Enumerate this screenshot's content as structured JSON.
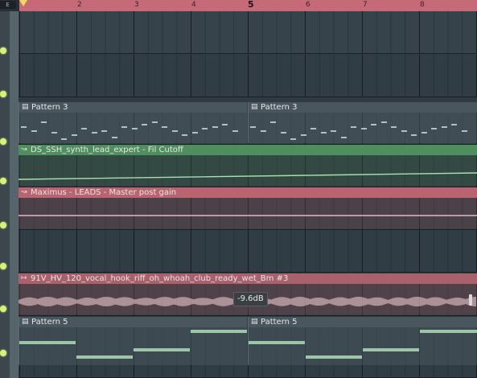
{
  "ruler": {
    "edit_label": "E",
    "bars": [
      "2",
      "3",
      "4",
      "5",
      "6",
      "7",
      "8"
    ]
  },
  "tracks": {
    "pattern3_label": "Pattern 3",
    "synth_auto_label": "DS_SSH_synth_lead_expert - Fil Cutoff",
    "leads_auto_label": "Maximus - LEADS - Master post gain",
    "audio_label": "91V_HV_120_vocal_hook_riff_oh_whoah_club_ready_wet_Bm #3",
    "pattern5_label": "Pattern 5"
  },
  "tooltip": {
    "gain": "-9.6dB"
  },
  "colors": {
    "ruler": "#c66a78",
    "automation_green": "#4f8f5d",
    "automation_red": "#b9646f",
    "audio": "#a9616c",
    "mute_led": "#d8f276"
  },
  "icons": {
    "pattern": "pattern-icon",
    "automation": "automation-icon",
    "audio": "audio-clip-icon"
  }
}
